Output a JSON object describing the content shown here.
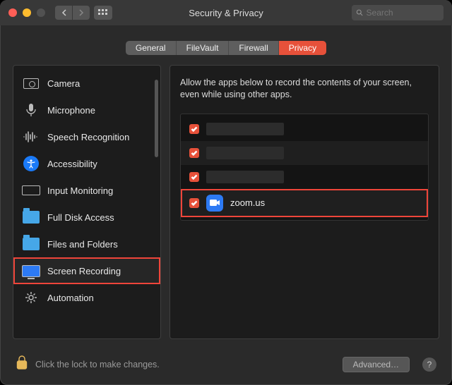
{
  "window": {
    "title": "Security & Privacy"
  },
  "search": {
    "placeholder": "Search"
  },
  "tabs": [
    {
      "label": "General",
      "active": false
    },
    {
      "label": "FileVault",
      "active": false
    },
    {
      "label": "Firewall",
      "active": false
    },
    {
      "label": "Privacy",
      "active": true
    }
  ],
  "sidebar": {
    "items": [
      {
        "label": "Camera",
        "icon": "camera-icon",
        "selected": false
      },
      {
        "label": "Microphone",
        "icon": "microphone-icon",
        "selected": false
      },
      {
        "label": "Speech Recognition",
        "icon": "waveform-icon",
        "selected": false
      },
      {
        "label": "Accessibility",
        "icon": "accessibility-icon",
        "selected": false
      },
      {
        "label": "Input Monitoring",
        "icon": "keyboard-icon",
        "selected": false
      },
      {
        "label": "Full Disk Access",
        "icon": "folder-icon",
        "selected": false
      },
      {
        "label": "Files and Folders",
        "icon": "folder-icon",
        "selected": false
      },
      {
        "label": "Screen Recording",
        "icon": "screen-icon",
        "selected": true
      },
      {
        "label": "Automation",
        "icon": "gear-icon",
        "selected": false
      }
    ]
  },
  "content": {
    "description": "Allow the apps below to record the contents of your screen, even while using other apps.",
    "apps": [
      {
        "checked": true,
        "name": "",
        "redacted": true,
        "highlight": false
      },
      {
        "checked": true,
        "name": "",
        "redacted": true,
        "highlight": false
      },
      {
        "checked": true,
        "name": "",
        "redacted": true,
        "highlight": false
      },
      {
        "checked": true,
        "name": "zoom.us",
        "redacted": false,
        "highlight": true,
        "app_icon": "video-camera-icon"
      }
    ]
  },
  "footer": {
    "lock_message": "Click the lock to make changes.",
    "advanced_label": "Advanced…"
  }
}
